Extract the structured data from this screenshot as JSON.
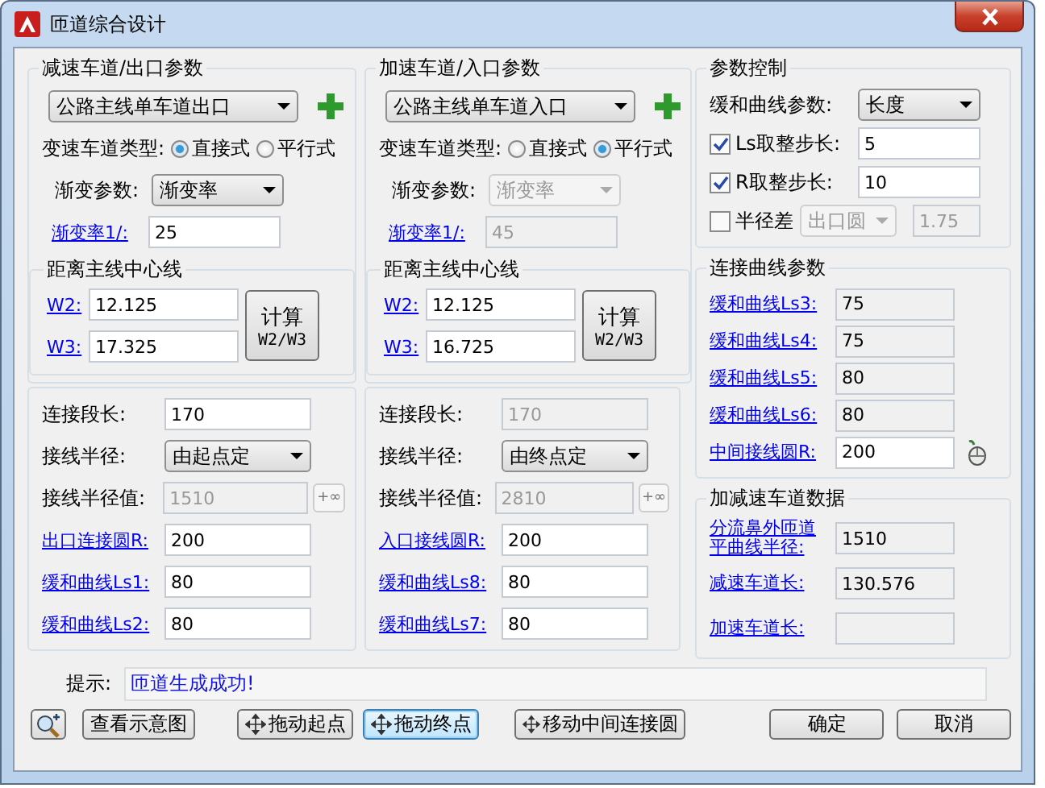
{
  "window": {
    "title": "匝道综合设计"
  },
  "ramps": [
    {
      "title": "减速车道/出口参数",
      "type_select": "公路主线单车道出口",
      "lane_type_label": "变速车道类型:",
      "radios": [
        {
          "label": "直接式",
          "selected": true
        },
        {
          "label": "平行式",
          "selected": false
        }
      ],
      "taper_label": "渐变参数:",
      "taper_select": {
        "value": "渐变率",
        "disabled": false
      },
      "taper_rate": {
        "label": "渐变率1/:",
        "value": "25",
        "disabled": false
      },
      "distance": {
        "title": "距离主线中心线",
        "fields": [
          {
            "label": "W2:",
            "value": "12.125"
          },
          {
            "label": "W3:",
            "value": "17.325"
          }
        ],
        "calc_button": [
          "计算",
          "W2/W3"
        ]
      },
      "rows": [
        {
          "kind": "field",
          "label": "连接段长:",
          "link": false,
          "value": "170",
          "disabled": false
        },
        {
          "kind": "select",
          "label": "接线半径:",
          "link": false,
          "value": "由起点定"
        },
        {
          "kind": "field_extra",
          "label": "接线半径值:",
          "link": false,
          "value": "1510",
          "disabled": true,
          "extra": "+∞"
        },
        {
          "kind": "field",
          "label": "出口连接圆R:",
          "link": true,
          "value": "200",
          "disabled": false
        },
        {
          "kind": "field",
          "label": "缓和曲线Ls1:",
          "link": true,
          "value": "80",
          "disabled": false
        },
        {
          "kind": "field",
          "label": "缓和曲线Ls2:",
          "link": true,
          "value": "80",
          "disabled": false
        }
      ]
    },
    {
      "title": "加速车道/入口参数",
      "type_select": "公路主线单车道入口",
      "lane_type_label": "变速车道类型:",
      "radios": [
        {
          "label": "直接式",
          "selected": false
        },
        {
          "label": "平行式",
          "selected": true
        }
      ],
      "taper_label": "渐变参数:",
      "taper_select": {
        "value": "渐变率",
        "disabled": true
      },
      "taper_rate": {
        "label": "渐变率1/:",
        "value": "45",
        "disabled": true
      },
      "distance": {
        "title": "距离主线中心线",
        "fields": [
          {
            "label": "W2:",
            "value": "12.125"
          },
          {
            "label": "W3:",
            "value": "16.725"
          }
        ],
        "calc_button": [
          "计算",
          "W2/W3"
        ]
      },
      "rows": [
        {
          "kind": "field",
          "label": "连接段长:",
          "link": false,
          "value": "170",
          "disabled": true
        },
        {
          "kind": "select",
          "label": "接线半径:",
          "link": false,
          "value": "由终点定"
        },
        {
          "kind": "field_extra",
          "label": "接线半径值:",
          "link": false,
          "value": "2810",
          "disabled": true,
          "extra": "+∞"
        },
        {
          "kind": "field",
          "label": "入口接线圆R:",
          "link": true,
          "value": "200",
          "disabled": false
        },
        {
          "kind": "field",
          "label": "缓和曲线Ls8:",
          "link": true,
          "value": "80",
          "disabled": false
        },
        {
          "kind": "field",
          "label": "缓和曲线Ls7:",
          "link": true,
          "value": "80",
          "disabled": false
        }
      ]
    }
  ],
  "control": {
    "title": "参数控制",
    "curve_label": "缓和曲线参数:",
    "curve_select": "长度",
    "checks": [
      {
        "label": "Ls取整步长:",
        "checked": true,
        "value": "5"
      },
      {
        "label": "R取整步长:",
        "checked": true,
        "value": "10"
      }
    ],
    "radius_diff": {
      "label": "半径差",
      "checked": false,
      "select": "出口圆",
      "value": "1.75"
    }
  },
  "connect": {
    "title": "连接曲线参数",
    "rows": [
      {
        "label": "缓和曲线Ls3:",
        "value": "75",
        "disabled": true
      },
      {
        "label": "缓和曲线Ls4:",
        "value": "75",
        "disabled": true
      },
      {
        "label": "缓和曲线Ls5:",
        "value": "80",
        "disabled": true
      },
      {
        "label": "缓和曲线Ls6:",
        "value": "80",
        "disabled": true
      },
      {
        "label": "中间接线圆R:",
        "value": "200",
        "disabled": false
      }
    ]
  },
  "lane_data": {
    "title": "加减速车道数据",
    "rows": [
      {
        "label": "分流鼻外匝道平曲线半径:",
        "value": "1510"
      },
      {
        "label": "减速车道长:",
        "value": "130.576"
      },
      {
        "label": "加速车道长:"
      }
    ]
  },
  "hint": {
    "label": "提示:",
    "value": "匝道生成成功!"
  },
  "buttons": [
    {
      "kind": "zoom"
    },
    {
      "kind": "text",
      "label": "查看示意图",
      "selected": false
    },
    {
      "kind": "move",
      "label": "拖动起点",
      "selected": false
    },
    {
      "kind": "move",
      "label": "拖动终点",
      "selected": true
    },
    {
      "kind": "move",
      "label": "移动中间连接圆",
      "selected": false
    },
    {
      "kind": "text",
      "label": "确定",
      "selected": false
    },
    {
      "kind": "text",
      "label": "取消",
      "selected": false
    }
  ]
}
